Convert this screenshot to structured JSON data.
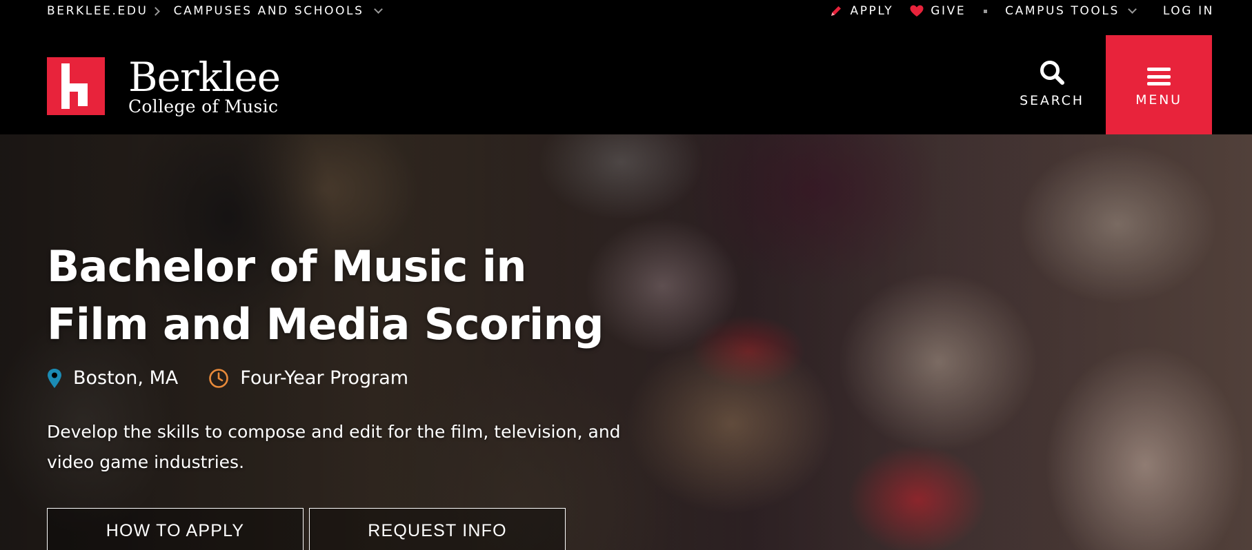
{
  "utility": {
    "left": {
      "root_link": "BERKLEE.EDU",
      "campuses_label": "CAMPUSES AND SCHOOLS"
    },
    "right": {
      "apply_label": "APPLY",
      "give_label": "GIVE",
      "campus_tools_label": "CAMPUS TOOLS",
      "login_label": "LOG IN"
    },
    "icons": {
      "apply": "pencil-icon",
      "give": "heart-icon"
    }
  },
  "header": {
    "logo": {
      "title": "Berklee",
      "subtitle": "College of Music"
    },
    "search_label": "SEARCH",
    "menu_label": "MENU"
  },
  "hero": {
    "title": "Bachelor of Music in Film and Media Scoring",
    "location": "Boston, MA",
    "program_length": "Four-Year Program",
    "description": "Develop the skills to compose and edit for the film, television, and video game industries.",
    "buttons": {
      "apply": "HOW TO APPLY",
      "request": "REQUEST INFO"
    }
  },
  "colors": {
    "brand_red": "#e8233b",
    "pin_blue": "#1b8bb4",
    "clock_orange": "#e98a3a",
    "background": "#000000"
  }
}
